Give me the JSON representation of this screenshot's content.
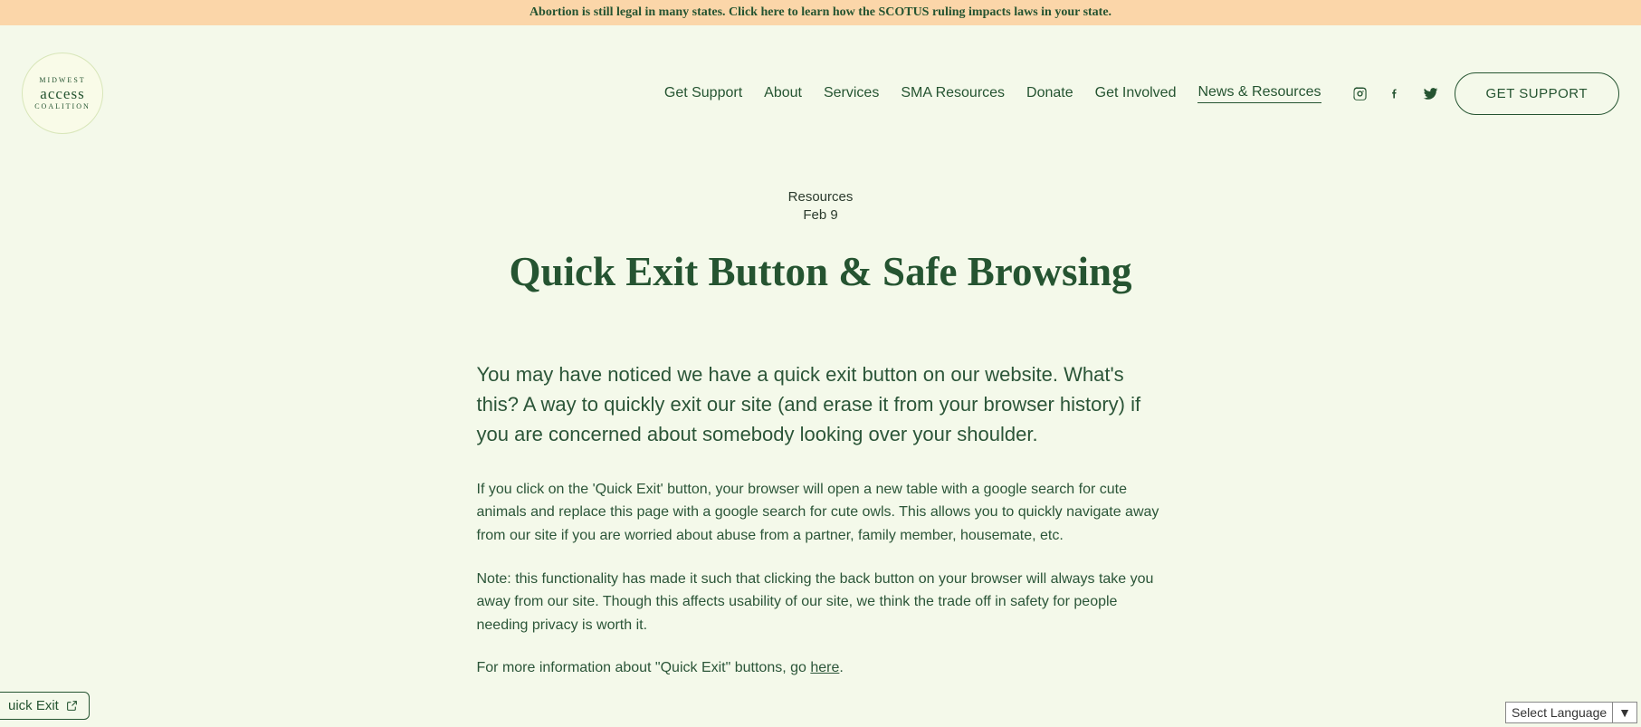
{
  "banner": {
    "text": "Abortion is still legal in many states. Click here to learn how the SCOTUS ruling impacts laws in your state."
  },
  "logo": {
    "line1": "MIDWEST",
    "line2": "access",
    "line3": "COALITION"
  },
  "nav": {
    "items": [
      {
        "label": "Get Support",
        "active": false
      },
      {
        "label": "About",
        "active": false
      },
      {
        "label": "Services",
        "active": false
      },
      {
        "label": "SMA Resources",
        "active": false
      },
      {
        "label": "Donate",
        "active": false
      },
      {
        "label": "Get Involved",
        "active": false
      },
      {
        "label": "News & Resources",
        "active": true
      }
    ]
  },
  "cta": {
    "label": "GET SUPPORT"
  },
  "article": {
    "category": "Resources",
    "date": "Feb 9",
    "title": "Quick Exit Button & Safe Browsing",
    "lead": "You may have noticed we have a quick exit button on our website. What's this? A way to quickly exit our site (and erase it from your browser history) if you are concerned about somebody looking over your shoulder.",
    "p1": "If you click on the 'Quick Exit' button, your browser will open a new table with a google search for cute animals and replace this page with a google search for cute owls. This allows you to quickly navigate away from our site if you are worried about abuse from a partner, family member, housemate, etc.",
    "p2": "Note: this functionality has made it such that clicking the back button on your browser will always take you away from our site. Though this affects usability of our site, we think the trade off in safety for people needing privacy is worth it.",
    "p3_prefix": "For more information about \"Quick Exit\" buttons, go ",
    "p3_link": "here",
    "p3_suffix": "."
  },
  "quick_exit": {
    "label": "uick Exit"
  },
  "lang": {
    "label": "Select Language",
    "arrow": "▼"
  },
  "colors": {
    "bg": "#f4f9ea",
    "accent": "#255431",
    "banner_bg": "#fbd6a9"
  }
}
